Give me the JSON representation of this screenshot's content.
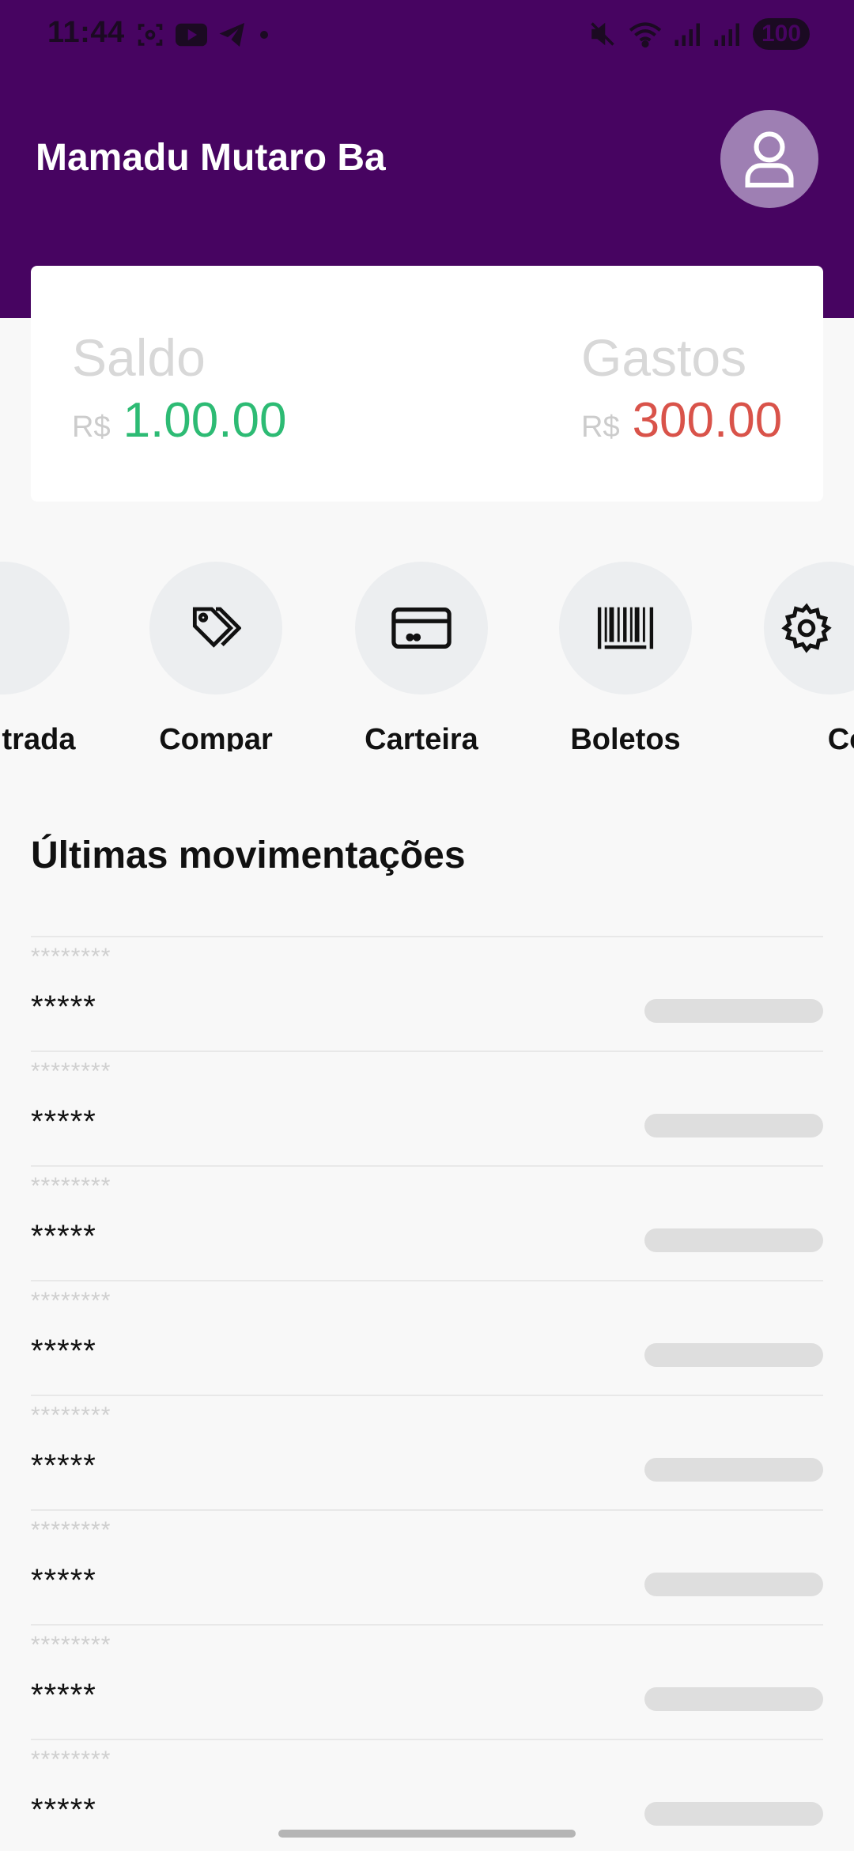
{
  "status_bar": {
    "time": "11:44",
    "battery": "100",
    "icons": [
      "screenshot-icon",
      "youtube-icon",
      "telegram-icon",
      "dot-icon",
      "mute-icon",
      "wifi-icon",
      "signal-icon",
      "signal-icon"
    ]
  },
  "header": {
    "user_name": "Mamadu Mutaro Ba",
    "avatar_icon": "user-icon"
  },
  "balance": {
    "saldo_label": "Saldo",
    "saldo_currency": "R$",
    "saldo_value": "1.00.00",
    "gastos_label": "Gastos",
    "gastos_currency": "R$",
    "gastos_value": "300.00"
  },
  "colors": {
    "header_bg": "#470461",
    "saldo_value": "#2dbb74",
    "gastos_value": "#d9534a",
    "avatar_bg": "#9e7fb3"
  },
  "actions": [
    {
      "label": "trada",
      "icon": "folder-plus-icon"
    },
    {
      "label": "Compar",
      "icon": "tags-icon"
    },
    {
      "label": "Carteira",
      "icon": "credit-card-icon"
    },
    {
      "label": "Boletos",
      "icon": "barcode-icon"
    },
    {
      "label": "Cont",
      "icon": "gear-icon"
    }
  ],
  "transactions_title": "Últimas movimentações",
  "transactions": [
    {
      "top": "********",
      "main": "*****"
    },
    {
      "top": "********",
      "main": "*****"
    },
    {
      "top": "********",
      "main": "*****"
    },
    {
      "top": "********",
      "main": "*****"
    },
    {
      "top": "********",
      "main": "*****"
    },
    {
      "top": "********",
      "main": "*****"
    },
    {
      "top": "********",
      "main": "*****"
    },
    {
      "top": "********",
      "main": "*****"
    }
  ]
}
